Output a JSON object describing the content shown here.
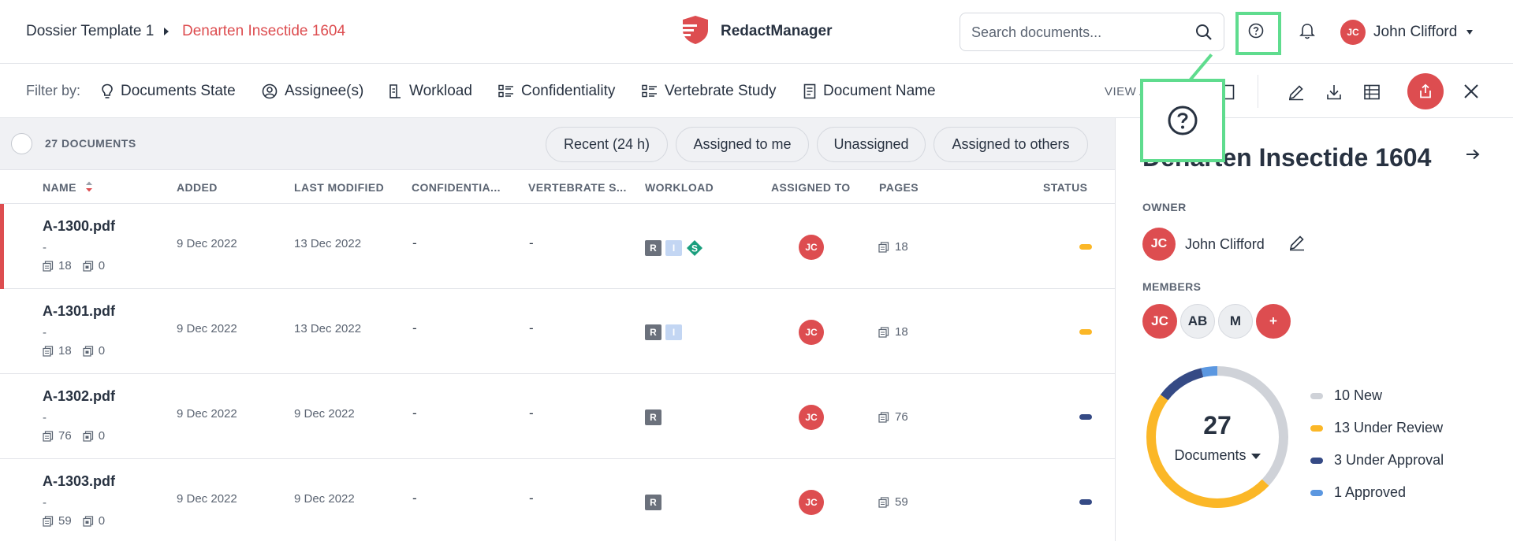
{
  "breadcrumb": {
    "parent": "Dossier Template 1",
    "current": "Denarten Insectide 1604"
  },
  "app": {
    "name": "RedactManager"
  },
  "search": {
    "placeholder": "Search documents..."
  },
  "user": {
    "initials": "JC",
    "name": "John Clifford"
  },
  "filters": {
    "label": "Filter by:",
    "items": [
      "Documents State",
      "Assignee(s)",
      "Workload",
      "Confidentiality",
      "Vertebrate Study",
      "Document Name"
    ]
  },
  "view_as": "VIEW A",
  "table": {
    "count_label": "27 DOCUMENTS",
    "chips": [
      "Recent (24 h)",
      "Assigned to me",
      "Unassigned",
      "Assigned to others"
    ],
    "columns": [
      "NAME",
      "ADDED",
      "LAST MODIFIED",
      "CONFIDENTIA...",
      "VERTEBRATE S...",
      "WORKLOAD",
      "ASSIGNED TO",
      "PAGES",
      "STATUS"
    ],
    "rows": [
      {
        "name": "A-1300.pdf",
        "sub": "-",
        "pages_a": "18",
        "pages_b": "0",
        "added": "9 Dec 2022",
        "modified": "13 Dec 2022",
        "conf": "-",
        "vert": "-",
        "workload": [
          "R",
          "I",
          "S"
        ],
        "assignee": "JC",
        "pages": "18",
        "status_color": "#fbb727"
      },
      {
        "name": "A-1301.pdf",
        "sub": "-",
        "pages_a": "18",
        "pages_b": "0",
        "added": "9 Dec 2022",
        "modified": "13 Dec 2022",
        "conf": "-",
        "vert": "-",
        "workload": [
          "R",
          "I"
        ],
        "assignee": "JC",
        "pages": "18",
        "status_color": "#fbb727"
      },
      {
        "name": "A-1302.pdf",
        "sub": "-",
        "pages_a": "76",
        "pages_b": "0",
        "added": "9 Dec 2022",
        "modified": "9 Dec 2022",
        "conf": "-",
        "vert": "-",
        "workload": [
          "R"
        ],
        "assignee": "JC",
        "pages": "76",
        "status_color": "#354a85"
      },
      {
        "name": "A-1303.pdf",
        "sub": "-",
        "pages_a": "59",
        "pages_b": "0",
        "added": "9 Dec 2022",
        "modified": "9 Dec 2022",
        "conf": "-",
        "vert": "-",
        "workload": [
          "R"
        ],
        "assignee": "JC",
        "pages": "59",
        "status_color": "#354a85"
      }
    ]
  },
  "panel": {
    "title": "Denarten Insectide 1604",
    "owner_label": "OWNER",
    "owner_initials": "JC",
    "owner_name": "John Clifford",
    "members_label": "MEMBERS",
    "members": [
      "JC",
      "AB",
      "M",
      "+"
    ],
    "total": "27",
    "total_label": "Documents",
    "legend": [
      {
        "label": "10 New",
        "value": 10,
        "color": "#cfd2d8"
      },
      {
        "label": "13 Under Review",
        "value": 13,
        "color": "#fbb727"
      },
      {
        "label": "3 Under Approval",
        "value": 3,
        "color": "#354a85"
      },
      {
        "label": "1 Approved",
        "value": 1,
        "color": "#5b97e0"
      }
    ]
  },
  "colors": {
    "accent": "#dd4d50",
    "highlight": "#5fdc8e"
  }
}
